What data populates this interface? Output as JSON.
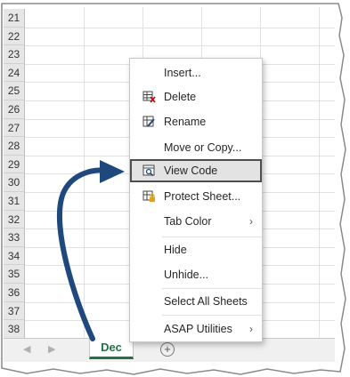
{
  "rows": [
    "21",
    "22",
    "23",
    "24",
    "25",
    "26",
    "27",
    "28",
    "29",
    "30",
    "31",
    "32",
    "33",
    "34",
    "35",
    "36",
    "37",
    "38"
  ],
  "active_tab": "Dec",
  "add_sheet_symbol": "+",
  "menu": {
    "insert": "Insert...",
    "delete": "Delete",
    "rename": "Rename",
    "move_copy": "Move or Copy...",
    "view_code": "View Code",
    "protect_sheet": "Protect Sheet...",
    "tab_color": "Tab Color",
    "hide": "Hide",
    "unhide": "Unhide...",
    "select_all": "Select All Sheets",
    "asap_utilities": "ASAP Utilities"
  },
  "colors": {
    "excel_green": "#217346",
    "arrow_blue": "#1f497d",
    "delete_red": "#c00000",
    "lock_orange": "#e0a020"
  }
}
